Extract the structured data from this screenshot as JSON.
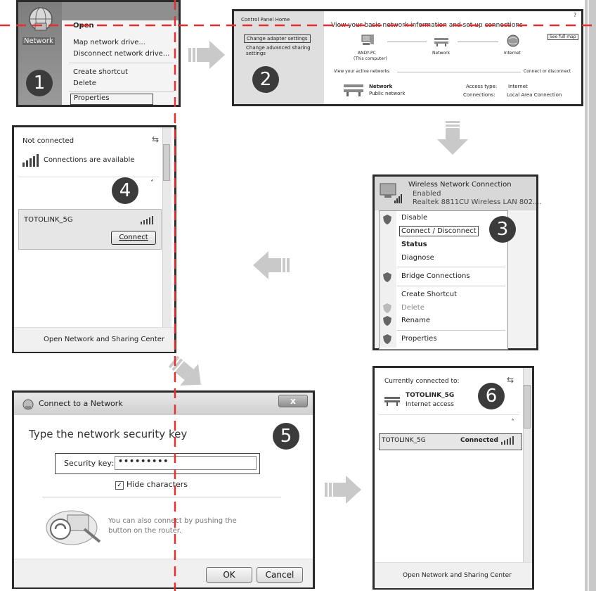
{
  "step_numbers": [
    "1",
    "2",
    "3",
    "4",
    "5",
    "6"
  ],
  "panel1": {
    "network_icon_label": "Network",
    "menu": [
      "Open",
      "Map network drive...",
      "Disconnect network drive...",
      "Create shortcut",
      "Delete",
      "Properties"
    ],
    "highlighted": "Properties"
  },
  "panel2": {
    "sidebar": [
      "Control Panel Home",
      "Change adapter settings",
      "Change advanced sharing settings"
    ],
    "highlighted": "Change adapter settings",
    "heading": "View your basic network information and set up connections",
    "see_full_map": "See full map",
    "nodes": [
      {
        "name": "ANDY-PC",
        "sub": "(This computer)"
      },
      {
        "name": "Network",
        "sub": ""
      },
      {
        "name": "Internet",
        "sub": ""
      }
    ],
    "active_networks_label": "View your active networks",
    "connect_or_disconnect": "Connect or disconnect",
    "network_name": "Network",
    "network_type": "Public network",
    "access_type_label": "Access type:",
    "access_type_value": "Internet",
    "connections_label": "Connections:",
    "connections_value": "Local Area Connection"
  },
  "panel3": {
    "adapter_title": "Wireless Network Connection",
    "adapter_status": "Enabled",
    "adapter_device": "Realtek 8811CU Wireless LAN 802....",
    "menu": [
      "Disable",
      "Connect / Disconnect",
      "Status",
      "Diagnose",
      "Bridge Connections",
      "Create Shortcut",
      "Delete",
      "Rename",
      "Properties"
    ],
    "highlighted": "Connect / Disconnect",
    "bold": "Status"
  },
  "panel4": {
    "status": "Not connected",
    "available": "Connections are available",
    "network": "TOTOLINK_5G",
    "connect_button": "Connect",
    "footer": "Open Network and Sharing Center"
  },
  "panel5": {
    "window_title": "Connect to a Network",
    "close_label": "x",
    "heading": "Type the network security key",
    "security_key_label": "Security key:",
    "security_key_value": "•••••••••",
    "hide_characters": "Hide characters",
    "hint_line1": "You can also connect by pushing the",
    "hint_line2": "button on the router.",
    "ok": "OK",
    "cancel": "Cancel"
  },
  "panel6": {
    "currently_connected": "Currently connected to:",
    "network": "TOTOLINK_5G",
    "access": "Internet access",
    "list_network": "TOTOLINK_5G",
    "list_status": "Connected",
    "footer": "Open Network and Sharing Center"
  },
  "colors": {
    "guide_line": "#e03030",
    "arrow": "#c9c9c9",
    "step_badge": "#3b3b3b",
    "frame": "#2a2a2a"
  }
}
